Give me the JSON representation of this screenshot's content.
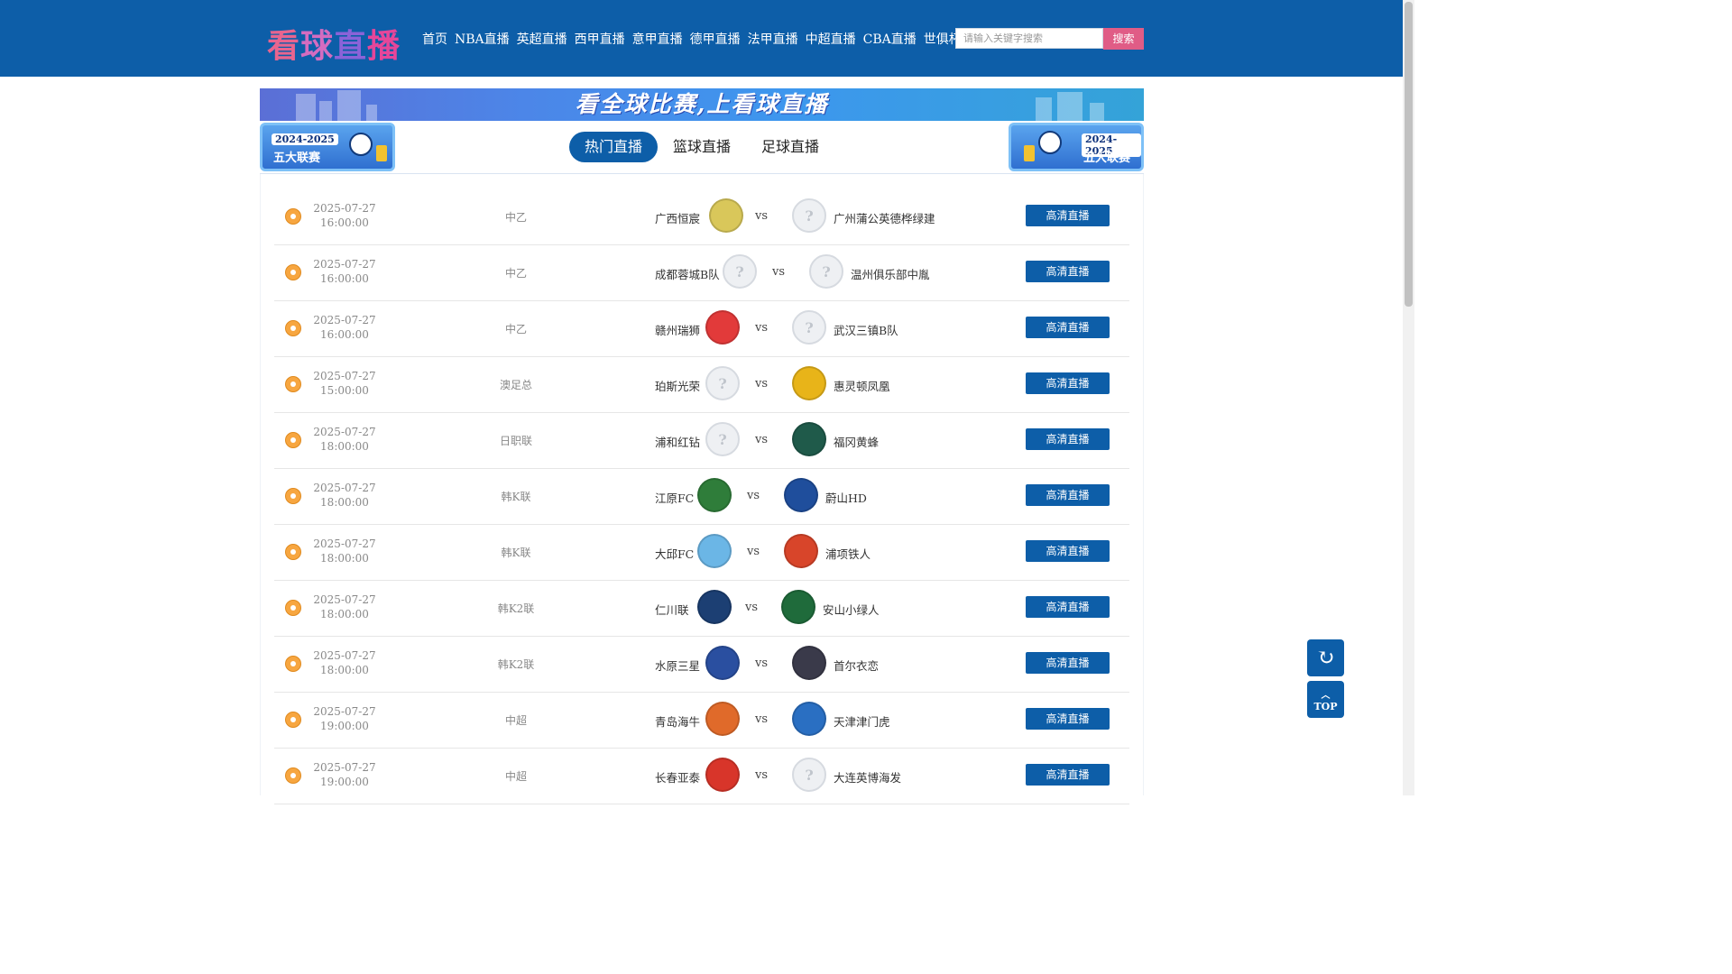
{
  "header": {
    "logo_chars": [
      "看",
      "球",
      "直",
      "播"
    ],
    "nav": [
      "首页",
      "NBA直播",
      "英超直播",
      "西甲直播",
      "意甲直播",
      "德甲直播",
      "法甲直播",
      "中超直播",
      "CBA直播",
      "世俱杯直播"
    ],
    "search_placeholder": "请输入关键字搜索",
    "search_button": "搜索"
  },
  "banner": {
    "text": "看全球比赛,上看球直播",
    "badge_left": {
      "year": "2024-2025",
      "title": "五大联赛"
    },
    "badge_right": {
      "year": "2024-2025",
      "title": "五大联赛"
    }
  },
  "tabs": [
    "热门直播",
    "篮球直播",
    "足球直播"
  ],
  "active_tab": 0,
  "live_button": "高清直播",
  "matches": [
    {
      "date": "2025-07-27",
      "time": "16:00:00",
      "league": "中乙",
      "home": "广西恒宸",
      "away": "广州蒲公英德桦绿建",
      "home_crest": "#d9c75a",
      "away_crest": "unknown"
    },
    {
      "date": "2025-07-27",
      "time": "16:00:00",
      "league": "中乙",
      "home": "成都蓉城B队",
      "away": "温州俱乐部中胤",
      "home_crest": "unknown",
      "away_crest": "unknown"
    },
    {
      "date": "2025-07-27",
      "time": "16:00:00",
      "league": "中乙",
      "home": "赣州瑞狮",
      "away": "武汉三镇B队",
      "home_crest": "#e23a3a",
      "away_crest": "unknown"
    },
    {
      "date": "2025-07-27",
      "time": "15:00:00",
      "league": "澳足总",
      "home": "珀斯光荣",
      "away": "惠灵顿凤凰",
      "home_crest": "unknown",
      "away_crest": "#e8b419"
    },
    {
      "date": "2025-07-27",
      "time": "18:00:00",
      "league": "日职联",
      "home": "浦和红钻",
      "away": "福冈黄蜂",
      "home_crest": "unknown",
      "away_crest": "#1f5a4a"
    },
    {
      "date": "2025-07-27",
      "time": "18:00:00",
      "league": "韩K联",
      "home": "江原FC",
      "away": "蔚山HD",
      "home_crest": "#2f7d3a",
      "away_crest": "#1f4e9c"
    },
    {
      "date": "2025-07-27",
      "time": "18:00:00",
      "league": "韩K联",
      "home": "大邱FC",
      "away": "浦项铁人",
      "home_crest": "#6bb6e6",
      "away_crest": "#d8452a"
    },
    {
      "date": "2025-07-27",
      "time": "18:00:00",
      "league": "韩K2联",
      "home": "仁川联",
      "away": "安山小绿人",
      "home_crest": "#1c3f73",
      "away_crest": "#1f6b3b"
    },
    {
      "date": "2025-07-27",
      "time": "18:00:00",
      "league": "韩K2联",
      "home": "水原三星",
      "away": "首尔衣恋",
      "home_crest": "#2a4fa0",
      "away_crest": "#3a3a4a"
    },
    {
      "date": "2025-07-27",
      "time": "19:00:00",
      "league": "中超",
      "home": "青岛海牛",
      "away": "天津津门虎",
      "home_crest": "#e06a2a",
      "away_crest": "#2a6fc2"
    },
    {
      "date": "2025-07-27",
      "time": "19:00:00",
      "league": "中超",
      "home": "长春亚泰",
      "away": "大连英博海发",
      "home_crest": "#d8352a",
      "away_crest": "unknown"
    }
  ],
  "float": {
    "refresh_icon": "↻",
    "top_label": "TOP"
  }
}
